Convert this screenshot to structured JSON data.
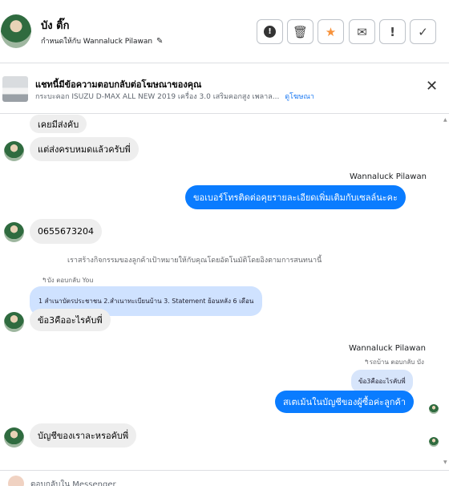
{
  "header": {
    "name": "บัง ติ๊ก",
    "assign_text": "กำหนดให้กับ Wannaluck Pilawan",
    "toolbar": {
      "info_icon": "!",
      "trash_icon": "🗑",
      "star_icon": "★",
      "archive_icon": "✉",
      "warning_icon": "!",
      "done_icon": "✓"
    }
  },
  "ad": {
    "title": "แชทนี้มีข้อความตอบกลับต่อโฆษณาของคุณ",
    "subtitle": "กระบะคอก ISUZU D-MAX ALL NEW 2019 เครื่อง 3.0 เสริมคอกสูง เพลาล...",
    "link": "ดูโฆษณา",
    "close": "✕"
  },
  "messages": {
    "m1": "เคยมีส่งคับ",
    "m2": "แต่ส่งครบหมดแล้วครับพี่",
    "sender1": "Wannaluck Pilawan",
    "m3": "ขอเบอร์โทรติดต่อคุยรายละเอียดเพิ่มเติมกับเซลล์นะคะ",
    "m4": "0655673204",
    "system": "เราสร้างกิจกรรมของลูกค้าเป้าหมายให้กับคุณโดยอัตโนมัติโดยอิงตามการสนทนานี้",
    "reply_meta1": "↰บัง ตอบกลับ You",
    "quote1": "1 สำเนาบัตรประชาชน 2.สำเนาทะเบียนบ้าน 3. Statement ย้อนหลัง 6 เดือน",
    "m5": "ข้อ3คืออะไรคับพี่",
    "sender2": "Wannaluck Pilawan",
    "reply_meta2": "↰รถบ้าน ตอบกลับ บัง",
    "quote2": "ข้อ3คืออะไรคับพี่",
    "m6": "สเตเม้นในบัญชีของผู้ซื้อค่ะลูกค้า",
    "m7": "บัญชีของเราละหรอคับพี่"
  },
  "composer": {
    "placeholder": "ตอบกลับใน Messenger"
  }
}
